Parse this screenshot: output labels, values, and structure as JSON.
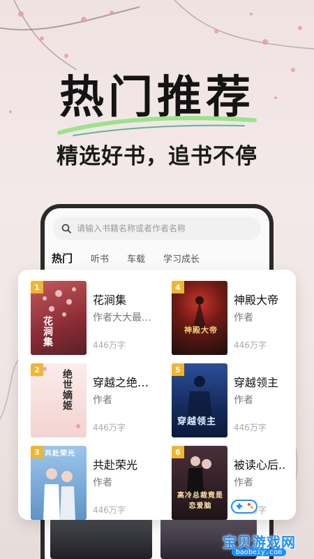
{
  "promo": {
    "title": "热门推荐",
    "subtitle": "精选好书，追书不停"
  },
  "search": {
    "placeholder": "请输入书籍名称或者作者名称"
  },
  "tabs": [
    {
      "label": "热门",
      "active": true
    },
    {
      "label": "听书",
      "active": false
    },
    {
      "label": "车载",
      "active": false
    },
    {
      "label": "学习成长",
      "active": false
    }
  ],
  "books": [
    {
      "rank": "1",
      "title": "花涧集",
      "author": "作者大大最…",
      "count": "446万字",
      "cover_text": "花涧集",
      "cover_color": "#9c3b3b"
    },
    {
      "rank": "4",
      "title": "神殿大帝",
      "author": "作者",
      "count": "446万字",
      "cover_text": "神殿大帝",
      "cover_color": "#3a1f16"
    },
    {
      "rank": "2",
      "title": "穿越之绝…",
      "author": "作者",
      "count": "446万字",
      "cover_text": "绝世嫡姬",
      "cover_color": "#f2d9d6"
    },
    {
      "rank": "5",
      "title": "穿越领主",
      "author": "作者",
      "count": "446万字",
      "cover_text": "穿越领主",
      "cover_color": "#1b3d7a"
    },
    {
      "rank": "3",
      "title": "共赴荣光",
      "author": "作者",
      "count": "446万字",
      "cover_text": "共赴荣光",
      "cover_color": "#6fa6d8"
    },
    {
      "rank": "6",
      "title": "被读心后..",
      "author": "作者",
      "count": "446万字",
      "cover_text": "高冷总裁竟是恋爱脑",
      "cover_color": "#2b1e22"
    }
  ],
  "watermark": {
    "text": "宝贝游戏网",
    "url": "baobeiy.com"
  },
  "colors": {
    "accent_green": "#9be38a",
    "rank_badge": "#f1b52f"
  }
}
